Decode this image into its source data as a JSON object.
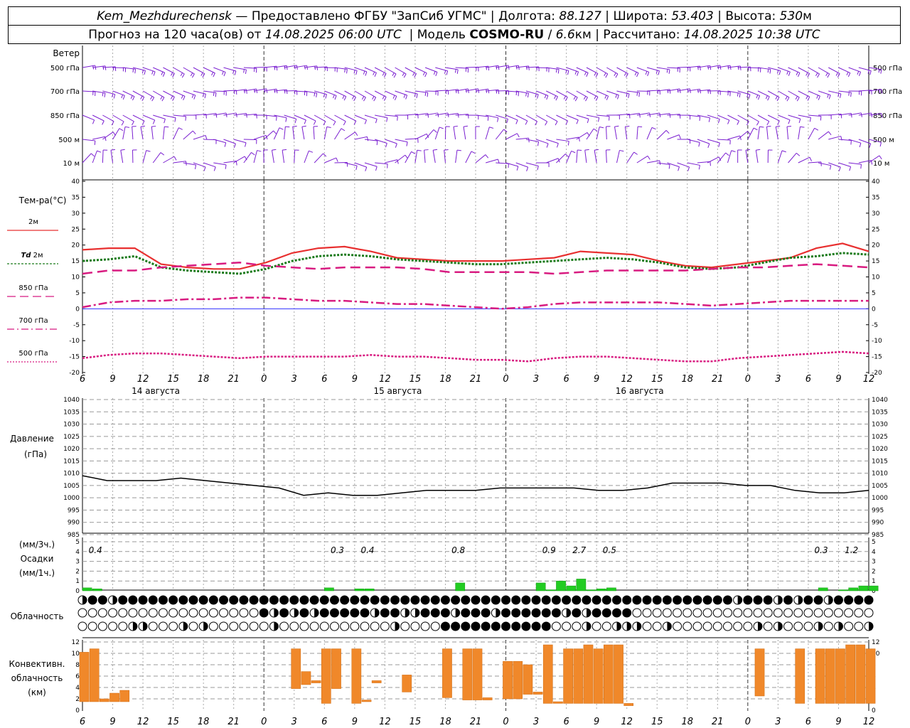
{
  "header": {
    "station": "Kem_Mezhdurechensk",
    "sep": " — ",
    "provider": "Предоставлено ФГБУ \"ЗапСиб УГМС\"",
    "lon_label": "Долгота:",
    "lon_value": "88.127",
    "lat_label": "Широта:",
    "lat_value": "53.403",
    "height_label": "Высота:",
    "height_value": "530",
    "height_unit": "м",
    "forecast_label": "Прогноз на 120 часа(ов) от",
    "forecast_start": "14.08.2025 06:00 UTC",
    "model_label": "Модель",
    "model_name": "COSMO-RU",
    "model_res": "6.6",
    "model_res_unit": "км",
    "calc_label": "Рассчитано:",
    "calc_time": "14.08.2025 10:38 UTC"
  },
  "wind_panel": {
    "title": "Ветер",
    "levels": [
      "500 гПа",
      "700 гПа",
      "850 гПа",
      "500  м",
      "10  м"
    ]
  },
  "temp_panel": {
    "title": "Тем-ра(°С)",
    "legend": [
      {
        "label": "2м",
        "color": "#e83030",
        "style": "solid"
      },
      {
        "label_bold": "Td",
        "label": " 2м",
        "color": "#1a7a1a",
        "style": "dotted"
      },
      {
        "label": "850 гПа",
        "color": "#d81b80",
        "style": "dashed"
      },
      {
        "label": "700 гПа",
        "color": "#d81b80",
        "style": "dashdot"
      },
      {
        "label": "500 гПа",
        "color": "#d81b80",
        "style": "dotted"
      }
    ]
  },
  "pressure_panel": {
    "title": "Давление",
    "unit": "(гПа)"
  },
  "precip_panel": {
    "label1": "(мм/3ч.)",
    "label2": "Осадки",
    "label3": "(мм/1ч.)"
  },
  "cloud_panel": {
    "title": "Облачность"
  },
  "conv_panel": {
    "label1": "Конвективн.",
    "label2": "облачность",
    "label3": "(км)"
  },
  "time_axis": {
    "hour_labels": [
      "6",
      "9",
      "12",
      "15",
      "18",
      "21",
      "0",
      "3",
      "6",
      "9",
      "12",
      "15",
      "18",
      "21",
      "0",
      "3",
      "6",
      "9",
      "12",
      "15",
      "18",
      "21",
      "0",
      "3",
      "6",
      "9",
      "12"
    ],
    "day_labels": [
      "14 августа",
      "15 августа",
      "16 августа"
    ]
  },
  "colors": {
    "grid": "#888888",
    "wind": "#7a1fd0",
    "precip": "#22cc22",
    "conv": "#f0882a",
    "pressure": "#000000",
    "zero_line": "#3030ff"
  },
  "chart_data": [
    {
      "type": "line",
      "title": "Тем-ра(°С)",
      "x_unit": "hours from 14.08.2025 00 UTC",
      "ylim": [
        -20,
        40
      ],
      "yticks": [
        -20,
        -15,
        -10,
        -5,
        0,
        5,
        10,
        15,
        20,
        25,
        30,
        35,
        40
      ],
      "x": [
        6,
        9,
        12,
        15,
        18,
        21,
        24,
        27,
        30,
        33,
        36,
        39,
        42,
        45,
        48,
        51,
        54,
        57,
        60,
        63,
        66,
        69,
        72,
        75,
        78,
        81,
        84
      ],
      "series": [
        {
          "name": "2м",
          "values": [
            18.5,
            19,
            19,
            14,
            13,
            12.5,
            12.5,
            14.5,
            17.5,
            19,
            19.5,
            18,
            16,
            15.5,
            15,
            15,
            15,
            15.5,
            16,
            18,
            17.5,
            17,
            15,
            13.5,
            13,
            14,
            15,
            16,
            19,
            20.5,
            18
          ]
        },
        {
          "name": "Td 2м",
          "values": [
            15,
            15.5,
            16.5,
            13,
            12,
            11.5,
            11,
            12.5,
            15,
            16.5,
            17,
            16.5,
            15.5,
            15,
            14.5,
            14,
            14,
            14.5,
            15,
            15.5,
            16,
            15.5,
            14.5,
            13,
            12.5,
            13,
            14.5,
            16,
            16.5,
            17.5,
            17
          ]
        },
        {
          "name": "850 гПа",
          "values": [
            11,
            12,
            12,
            13,
            13.5,
            14,
            14.5,
            13.5,
            13,
            12.5,
            13,
            13,
            13,
            12.5,
            11.5,
            11.5,
            11.5,
            11.5,
            11,
            11.5,
            12,
            12,
            12,
            12,
            12.5,
            13,
            13,
            13.5,
            14,
            13.5,
            13
          ]
        },
        {
          "name": "700 гПа",
          "values": [
            0.5,
            2,
            2.5,
            2.5,
            3,
            3,
            3.5,
            3.5,
            3,
            2.5,
            2.5,
            2,
            1.5,
            1.5,
            1,
            0.5,
            0,
            0.5,
            1.5,
            2,
            2,
            2,
            2,
            1.5,
            1,
            1.5,
            2,
            2.5,
            2.5,
            2.5,
            2.5
          ]
        },
        {
          "name": "500 гПа",
          "values": [
            -15.5,
            -14.5,
            -14,
            -14,
            -14.5,
            -15,
            -15.5,
            -15,
            -15,
            -15,
            -15,
            -14.5,
            -15,
            -15,
            -15.5,
            -16,
            -16,
            -16.5,
            -15.5,
            -15,
            -15,
            -15.5,
            -16,
            -16.5,
            -16.5,
            -15.5,
            -15,
            -14.5,
            -14,
            -13.5,
            -14
          ]
        }
      ]
    },
    {
      "type": "line",
      "title": "Давление",
      "ylim": [
        985,
        1040
      ],
      "yticks": [
        985,
        990,
        995,
        1000,
        1005,
        1010,
        1015,
        1020,
        1025,
        1030,
        1035,
        1040
      ],
      "series": [
        {
          "name": "Давление",
          "values": [
            1009,
            1007,
            1007,
            1007,
            1008,
            1007,
            1006,
            1005,
            1004,
            1001,
            1002,
            1001,
            1001,
            1002,
            1003,
            1003,
            1003,
            1004,
            1004,
            1004,
            1004,
            1003,
            1003,
            1004,
            1006,
            1006,
            1006,
            1005,
            1005,
            1003,
            1002,
            1002,
            1003
          ]
        }
      ]
    },
    {
      "type": "bar",
      "title": "Осадки",
      "ylim": [
        0,
        5
      ],
      "yticks": [
        0,
        1,
        2,
        3,
        4,
        5
      ],
      "three_hour_totals": [
        {
          "hour": 7,
          "value": "0.4"
        },
        {
          "hour": 31,
          "value": "0.3"
        },
        {
          "hour": 34,
          "value": "0.4"
        },
        {
          "hour": 43,
          "value": "0.8"
        },
        {
          "hour": 52,
          "value": "0.9"
        },
        {
          "hour": 55,
          "value": "2.7"
        },
        {
          "hour": 58,
          "value": "0.5"
        },
        {
          "hour": 79,
          "value": "0.3"
        },
        {
          "hour": 82,
          "value": "1.2"
        }
      ],
      "hourly": [
        {
          "hour": 6,
          "value": 0.3
        },
        {
          "hour": 7,
          "value": 0.2
        },
        {
          "hour": 30,
          "value": 0.3
        },
        {
          "hour": 33,
          "value": 0.2
        },
        {
          "hour": 34,
          "value": 0.2
        },
        {
          "hour": 43,
          "value": 0.8
        },
        {
          "hour": 51,
          "value": 0.8
        },
        {
          "hour": 52,
          "value": 0.1
        },
        {
          "hour": 53,
          "value": 1.0
        },
        {
          "hour": 54,
          "value": 0.5
        },
        {
          "hour": 55,
          "value": 1.2
        },
        {
          "hour": 56,
          "value": 0.1
        },
        {
          "hour": 57,
          "value": 0.2
        },
        {
          "hour": 58,
          "value": 0.3
        },
        {
          "hour": 79,
          "value": 0.3
        },
        {
          "hour": 81,
          "value": 0.1
        },
        {
          "hour": 82,
          "value": 0.3
        },
        {
          "hour": 83,
          "value": 0.5
        },
        {
          "hour": 84,
          "value": 0.5
        }
      ]
    },
    {
      "type": "bar",
      "title": "Конвективн. облачность (км)",
      "ylim": [
        0,
        12
      ],
      "yticks": [
        0,
        2,
        4,
        6,
        8,
        10,
        12
      ],
      "ranges": [
        {
          "hour": 6,
          "base": 1.5,
          "top": 10.2
        },
        {
          "hour": 7,
          "base": 1.5,
          "top": 10.8
        },
        {
          "hour": 8,
          "base": 1.5,
          "top": 2
        },
        {
          "hour": 9,
          "base": 1.5,
          "top": 3
        },
        {
          "hour": 10,
          "base": 1.5,
          "top": 3.5
        },
        {
          "hour": 27,
          "base": 3.8,
          "top": 10.8
        },
        {
          "hour": 28,
          "base": 4.5,
          "top": 6.8
        },
        {
          "hour": 29,
          "base": 4.8,
          "top": 5.2
        },
        {
          "hour": 30,
          "base": 1.2,
          "top": 10.8
        },
        {
          "hour": 31,
          "base": 3.8,
          "top": 10.8
        },
        {
          "hour": 33,
          "base": 1.2,
          "top": 10.8
        },
        {
          "hour": 34,
          "base": 1.5,
          "top": 1.8
        },
        {
          "hour": 35,
          "base": 4.8,
          "top": 5.2
        },
        {
          "hour": 38,
          "base": 3.2,
          "top": 6.2
        },
        {
          "hour": 42,
          "base": 2.2,
          "top": 10.8
        },
        {
          "hour": 44,
          "base": 1.8,
          "top": 10.8
        },
        {
          "hour": 45,
          "base": 1.8,
          "top": 10.8
        },
        {
          "hour": 46,
          "base": 1.8,
          "top": 2.2
        },
        {
          "hour": 48,
          "base": 2,
          "top": 8.6
        },
        {
          "hour": 49,
          "base": 2,
          "top": 8.6
        },
        {
          "hour": 50,
          "base": 2.8,
          "top": 8
        },
        {
          "hour": 51,
          "base": 2.8,
          "top": 3.2
        },
        {
          "hour": 52,
          "base": 1.2,
          "top": 11.5
        },
        {
          "hour": 53,
          "base": 1.2,
          "top": 1.5
        },
        {
          "hour": 54,
          "base": 1.2,
          "top": 10.8
        },
        {
          "hour": 55,
          "base": 1.2,
          "top": 10.8
        },
        {
          "hour": 56,
          "base": 1.2,
          "top": 11.5
        },
        {
          "hour": 57,
          "base": 1.2,
          "top": 10.8
        },
        {
          "hour": 58,
          "base": 1.2,
          "top": 11.5
        },
        {
          "hour": 59,
          "base": 1.2,
          "top": 11.5
        },
        {
          "hour": 60,
          "base": 0.8,
          "top": 1.2
        },
        {
          "hour": 73,
          "base": 2.5,
          "top": 10.8
        },
        {
          "hour": 77,
          "base": 1.2,
          "top": 10.8
        },
        {
          "hour": 79,
          "base": 1.2,
          "top": 10.8
        },
        {
          "hour": 80,
          "base": 1.2,
          "top": 10.8
        },
        {
          "hour": 81,
          "base": 1.2,
          "top": 10.8
        },
        {
          "hour": 82,
          "base": 1.2,
          "top": 11.5
        },
        {
          "hour": 83,
          "base": 1.2,
          "top": 11.5
        },
        {
          "hour": 84,
          "base": 1.2,
          "top": 10.8
        }
      ]
    }
  ]
}
